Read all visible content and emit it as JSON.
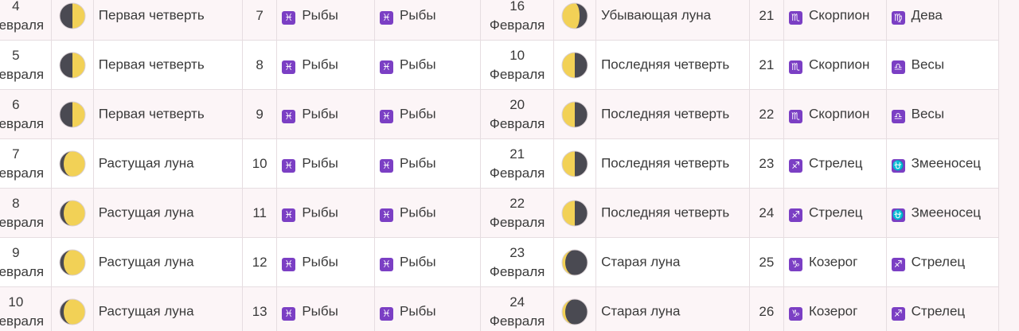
{
  "colors": {
    "zodiac_badge": "#7b3fc4",
    "moon_light": "#f2d156",
    "moon_dark": "#4a4a52"
  },
  "rows": [
    {
      "left": {
        "day": "4",
        "month": "февраля",
        "moon_icon": "moon-first-quarter-icon",
        "phase": "Первая четверть",
        "lunar_day": "7",
        "sign1": "Рыбы",
        "sign1_icon": "pisces-icon",
        "sign2": "Рыбы",
        "sign2_icon": "pisces-icon"
      },
      "right": {
        "day": "16",
        "month": "Февраля",
        "moon_icon": "moon-waning-icon",
        "phase": "Убывающая луна",
        "lunar_day": "21",
        "sign1": "Скорпион",
        "sign1_icon": "scorpio-icon",
        "sign2": "Дева",
        "sign2_icon": "virgo-icon"
      }
    },
    {
      "left": {
        "day": "5",
        "month": "февраля",
        "moon_icon": "moon-first-quarter-icon",
        "phase": "Первая четверть",
        "lunar_day": "8",
        "sign1": "Рыбы",
        "sign1_icon": "pisces-icon",
        "sign2": "Рыбы",
        "sign2_icon": "pisces-icon"
      },
      "right": {
        "day": "10",
        "month": "Февраля",
        "moon_icon": "moon-last-quarter-icon",
        "phase": "Последняя четверть",
        "lunar_day": "21",
        "sign1": "Скорпион",
        "sign1_icon": "scorpio-icon",
        "sign2": "Весы",
        "sign2_icon": "libra-icon"
      }
    },
    {
      "left": {
        "day": "6",
        "month": "февраля",
        "moon_icon": "moon-first-quarter-icon",
        "phase": "Первая четверть",
        "lunar_day": "9",
        "sign1": "Рыбы",
        "sign1_icon": "pisces-icon",
        "sign2": "Рыбы",
        "sign2_icon": "pisces-icon"
      },
      "right": {
        "day": "20",
        "month": "Февраля",
        "moon_icon": "moon-last-quarter-icon",
        "phase": "Последняя четверть",
        "lunar_day": "22",
        "sign1": "Скорпион",
        "sign1_icon": "scorpio-icon",
        "sign2": "Весы",
        "sign2_icon": "libra-icon"
      }
    },
    {
      "left": {
        "day": "7",
        "month": "февраля",
        "moon_icon": "moon-waxing-icon",
        "phase": "Растущая луна",
        "lunar_day": "10",
        "sign1": "Рыбы",
        "sign1_icon": "pisces-icon",
        "sign2": "Рыбы",
        "sign2_icon": "pisces-icon"
      },
      "right": {
        "day": "21",
        "month": "Февраля",
        "moon_icon": "moon-last-quarter-icon",
        "phase": "Последняя четверть",
        "lunar_day": "23",
        "sign1": "Стрелец",
        "sign1_icon": "sagittarius-icon",
        "sign2": "Змееносец",
        "sign2_icon": "ophiuchus-icon"
      }
    },
    {
      "left": {
        "day": "8",
        "month": "февраля",
        "moon_icon": "moon-waxing-icon",
        "phase": "Растущая луна",
        "lunar_day": "11",
        "sign1": "Рыбы",
        "sign1_icon": "pisces-icon",
        "sign2": "Рыбы",
        "sign2_icon": "pisces-icon"
      },
      "right": {
        "day": "22",
        "month": "Февраля",
        "moon_icon": "moon-last-quarter-icon",
        "phase": "Последняя четверть",
        "lunar_day": "24",
        "sign1": "Стрелец",
        "sign1_icon": "sagittarius-icon",
        "sign2": "Змееносец",
        "sign2_icon": "ophiuchus-icon"
      }
    },
    {
      "left": {
        "day": "9",
        "month": "февраля",
        "moon_icon": "moon-waxing-icon",
        "phase": "Растущая луна",
        "lunar_day": "12",
        "sign1": "Рыбы",
        "sign1_icon": "pisces-icon",
        "sign2": "Рыбы",
        "sign2_icon": "pisces-icon"
      },
      "right": {
        "day": "23",
        "month": "Февраля",
        "moon_icon": "moon-old-icon",
        "phase": "Старая луна",
        "lunar_day": "25",
        "sign1": "Козерог",
        "sign1_icon": "capricorn-icon",
        "sign2": "Стрелец",
        "sign2_icon": "sagittarius-icon"
      }
    },
    {
      "left": {
        "day": "10",
        "month": "февраля",
        "moon_icon": "moon-waxing-icon",
        "phase": "Растущая луна",
        "lunar_day": "13",
        "sign1": "Рыбы",
        "sign1_icon": "pisces-icon",
        "sign2": "Рыбы",
        "sign2_icon": "pisces-icon"
      },
      "right": {
        "day": "24",
        "month": "Февраля",
        "moon_icon": "moon-old-icon",
        "phase": "Старая луна",
        "lunar_day": "26",
        "sign1": "Козерог",
        "sign1_icon": "capricorn-icon",
        "sign2": "Стрелец",
        "sign2_icon": "sagittarius-icon"
      }
    }
  ]
}
